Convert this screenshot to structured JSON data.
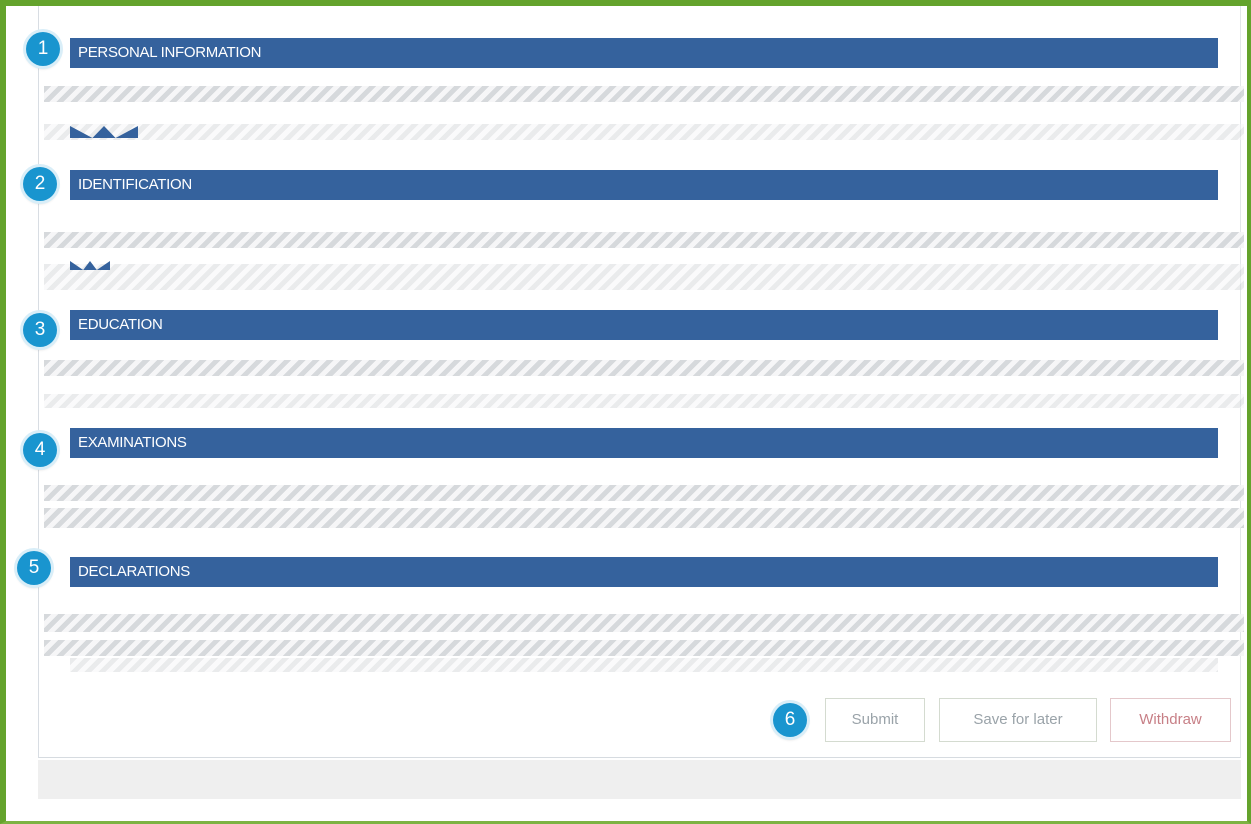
{
  "sections": [
    {
      "number": "1",
      "title": "PERSONAL INFORMATION"
    },
    {
      "number": "2",
      "title": "IDENTIFICATION"
    },
    {
      "number": "3",
      "title": "EDUCATION"
    },
    {
      "number": "4",
      "title": "EXAMINATIONS"
    },
    {
      "number": "5",
      "title": "DECLARATIONS"
    }
  ],
  "actions": {
    "number": "6",
    "submit_label": "Submit",
    "save_label": "Save for later",
    "withdraw_label": "Withdraw"
  },
  "colors": {
    "frame_border": "#64a32c",
    "section_header": "#35629d",
    "badge": "#1995cf",
    "withdraw_text": "#c77f86"
  }
}
